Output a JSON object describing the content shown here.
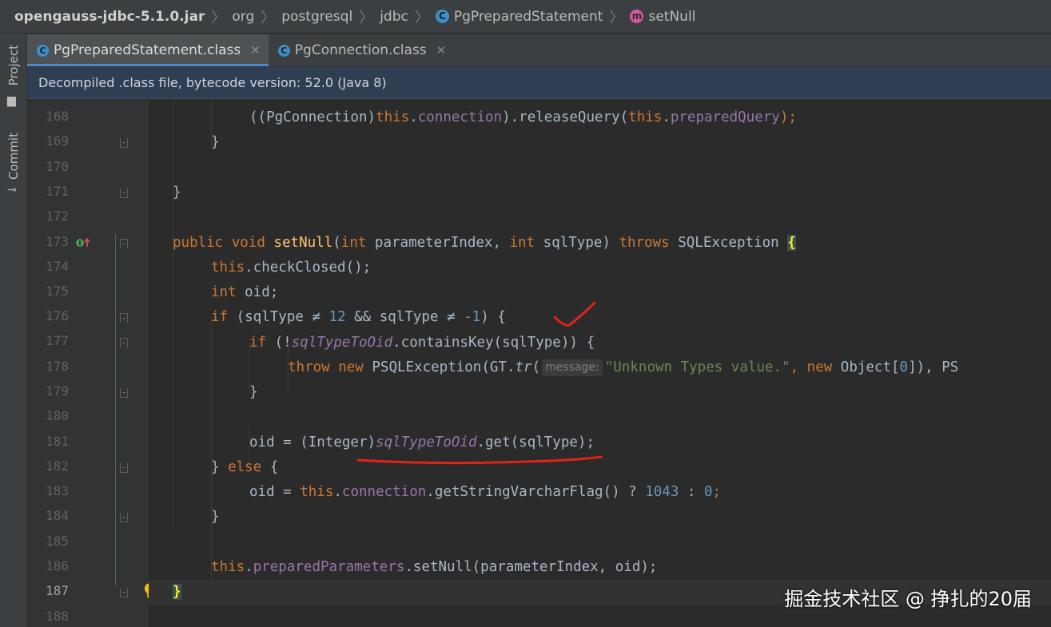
{
  "breadcrumb": {
    "jar": "opengauss-jdbc-5.1.0.jar",
    "org": "org",
    "postgresql": "postgresql",
    "jdbc": "jdbc",
    "class": "PgPreparedStatement",
    "method": "setNull"
  },
  "toolstrip": {
    "project": "Project",
    "commit": "Commit"
  },
  "tabs": [
    {
      "label": "PgPreparedStatement.class"
    },
    {
      "label": "PgConnection.class"
    }
  ],
  "banner": "Decompiled .class file, bytecode version: 52.0 (Java 8)",
  "line_numbers": [
    "168",
    "169",
    "170",
    "171",
    "172",
    "173",
    "174",
    "175",
    "176",
    "177",
    "178",
    "179",
    "180",
    "181",
    "182",
    "183",
    "184",
    "185",
    "186",
    "187",
    "188"
  ],
  "code": {
    "l168": {
      "a": "((PgConnection)",
      "b": "this",
      "c": ".",
      "d": "connection",
      "e": ").releaseQuery(",
      "f": "this",
      "g": ".",
      "h": "preparedQuery",
      "i": ");"
    },
    "l169": {
      "a": "}"
    },
    "l171": {
      "a": "}"
    },
    "l173": {
      "a": "public",
      "b": " ",
      "c": "void",
      "d": " ",
      "e": "setNull",
      "f": "(",
      "g": "int",
      "h": " parameterIndex, ",
      "i": "int",
      "j": " sqlType) ",
      "k": "throws",
      "l": " SQLException ",
      "m": "{"
    },
    "l174": {
      "a": "this",
      "b": ".checkClosed();"
    },
    "l175": {
      "a": "int",
      "b": " oid;"
    },
    "l176": {
      "a": "if",
      "b": " (sqlType ≠ ",
      "c": "12",
      "d": " && sqlType ≠ ",
      "e": "-1",
      "f": ") {"
    },
    "l177": {
      "a": "if",
      "b": " (!",
      "c": "sqlTypeToOid",
      "d": ".containsKey(sqlType)) {"
    },
    "l178": {
      "a": "throw",
      "b": " ",
      "c": "new",
      "d": " PSQLException(GT.",
      "e": "tr",
      "f": "(",
      "hint": "message:",
      "g": "\"Unknown Types value.\"",
      "h": ", ",
      "i": "new",
      "j": " Object[",
      "k": "0",
      "l": "]), PS"
    },
    "l179": {
      "a": "}"
    },
    "l181": {
      "a": "oid = (Integer)",
      "b": "sqlTypeToOid",
      "c": ".get(sqlType);"
    },
    "l182": {
      "a": "} ",
      "b": "else",
      "c": " {"
    },
    "l183": {
      "a": "oid = ",
      "b": "this",
      "c": ".",
      "d": "connection",
      "e": ".getStringVarcharFlag() ? ",
      "f": "1043",
      "g": " : ",
      "h": "0",
      "i": ";"
    },
    "l184": {
      "a": "}"
    },
    "l186": {
      "a": "this",
      "b": ".",
      "c": "preparedParameters",
      "d": ".setNull(parameterIndex, oid);"
    },
    "l187": {
      "a": "}"
    }
  },
  "watermark": "掘金技术社区 @ 挣扎的20届",
  "colors": {
    "keyword": "#cc7832",
    "method": "#ffc66d",
    "field": "#9876aa",
    "number": "#6897bb",
    "string": "#6a8759",
    "annotation_red": "#e0241a"
  }
}
